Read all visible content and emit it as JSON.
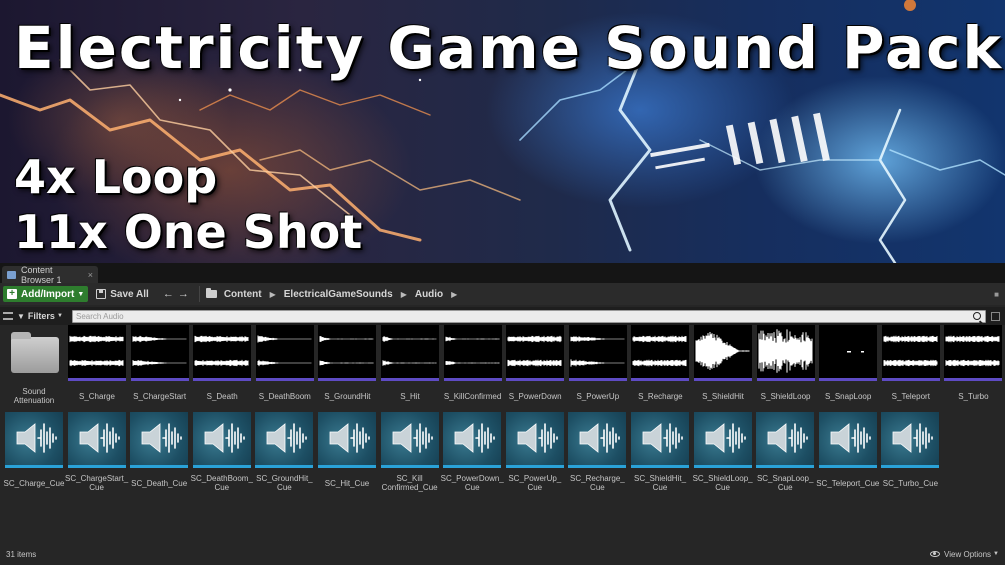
{
  "banner": {
    "title": "Electricity Game Sound Pack",
    "line1": "4x Loop",
    "line2": "11x One Shot"
  },
  "tab": {
    "label": "Content Browser 1"
  },
  "toolbar": {
    "add_label": "Add/Import",
    "save_label": "Save All",
    "breadcrumbs": [
      "Content",
      "ElectricalGameSounds",
      "Audio"
    ]
  },
  "filterbar": {
    "filters_label": "Filters",
    "search_placeholder": "Search Audio"
  },
  "folder": {
    "label": "Sound Attenuation"
  },
  "waves": [
    "S_Charge",
    "S_ChargeStart",
    "S_Death",
    "S_DeathBoom",
    "S_GroundHit",
    "S_Hit",
    "S_KillConfirmed",
    "S_PowerDown",
    "S_PowerUp",
    "S_Recharge",
    "S_ShieldHit",
    "S_ShieldLoop",
    "S_SnapLoop",
    "S_Teleport",
    "S_Turbo"
  ],
  "cues": [
    [
      "SC_Charge_Cue"
    ],
    [
      "SC_ChargeStart_",
      "Cue"
    ],
    [
      "SC_Death_Cue"
    ],
    [
      "SC_DeathBoom_",
      "Cue"
    ],
    [
      "SC_GroundHit_",
      "Cue"
    ],
    [
      "SC_Hit_Cue"
    ],
    [
      "SC_Kill",
      "Confirmed_Cue"
    ],
    [
      "SC_PowerDown_",
      "Cue"
    ],
    [
      "SC_PowerUp_",
      "Cue"
    ],
    [
      "SC_Recharge_",
      "Cue"
    ],
    [
      "SC_ShieldHit_",
      "Cue"
    ],
    [
      "SC_ShieldLoop_",
      "Cue"
    ],
    [
      "SC_SnapLoop_",
      "Cue"
    ],
    [
      "SC_Teleport_Cue"
    ],
    [
      "SC_Turbo_Cue"
    ]
  ],
  "status": {
    "count": "31 items",
    "view_options": "View Options"
  },
  "colors": {
    "add_button": "#2e7d2e",
    "wave_bar": "#5e4bc4",
    "cue_bar": "#2aa2d8"
  }
}
